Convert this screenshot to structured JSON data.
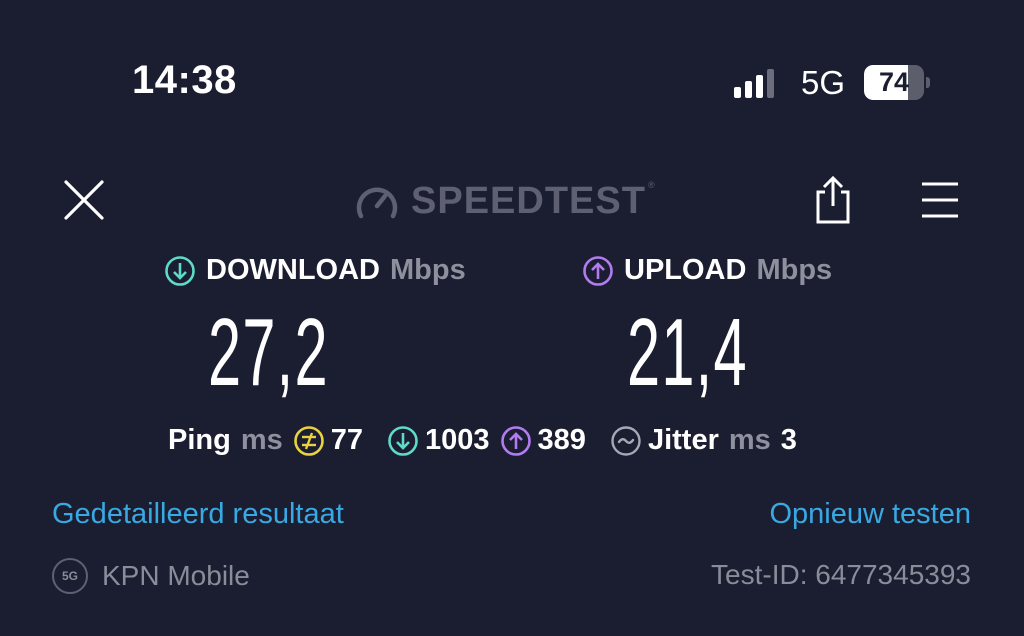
{
  "status_bar": {
    "time": "14:38",
    "network": "5G",
    "battery_level": "74",
    "battery_fraction": 0.74,
    "signal_bars_active": 3,
    "signal_bars_total": 4
  },
  "header": {
    "logo_text": "SPEEDTEST",
    "logo_tm": "®",
    "close_icon": "close-icon",
    "share_icon": "share-icon",
    "menu_icon": "hamburger-menu-icon"
  },
  "download": {
    "label": "DOWNLOAD",
    "unit": "Mbps",
    "value": "27,2",
    "icon": "download-arrow-icon",
    "color": "#5ddbc7"
  },
  "upload": {
    "label": "UPLOAD",
    "unit": "Mbps",
    "value": "21,4",
    "icon": "upload-arrow-icon",
    "color": "#b17cf0"
  },
  "stats": {
    "ping_label": "Ping",
    "ping_unit": "ms",
    "ping_idle": "77",
    "ping_download": "1003",
    "ping_upload": "389",
    "jitter_label": "Jitter",
    "jitter_unit": "ms",
    "jitter_value": "3",
    "ping_color": "#e8d23f"
  },
  "links": {
    "detailed_result": "Gedetailleerd resultaat",
    "test_again": "Opnieuw testen",
    "color": "#39a9e3"
  },
  "footer": {
    "carrier_badge": "5G",
    "carrier": "KPN Mobile",
    "test_id": "Test-ID: 6477345393"
  }
}
